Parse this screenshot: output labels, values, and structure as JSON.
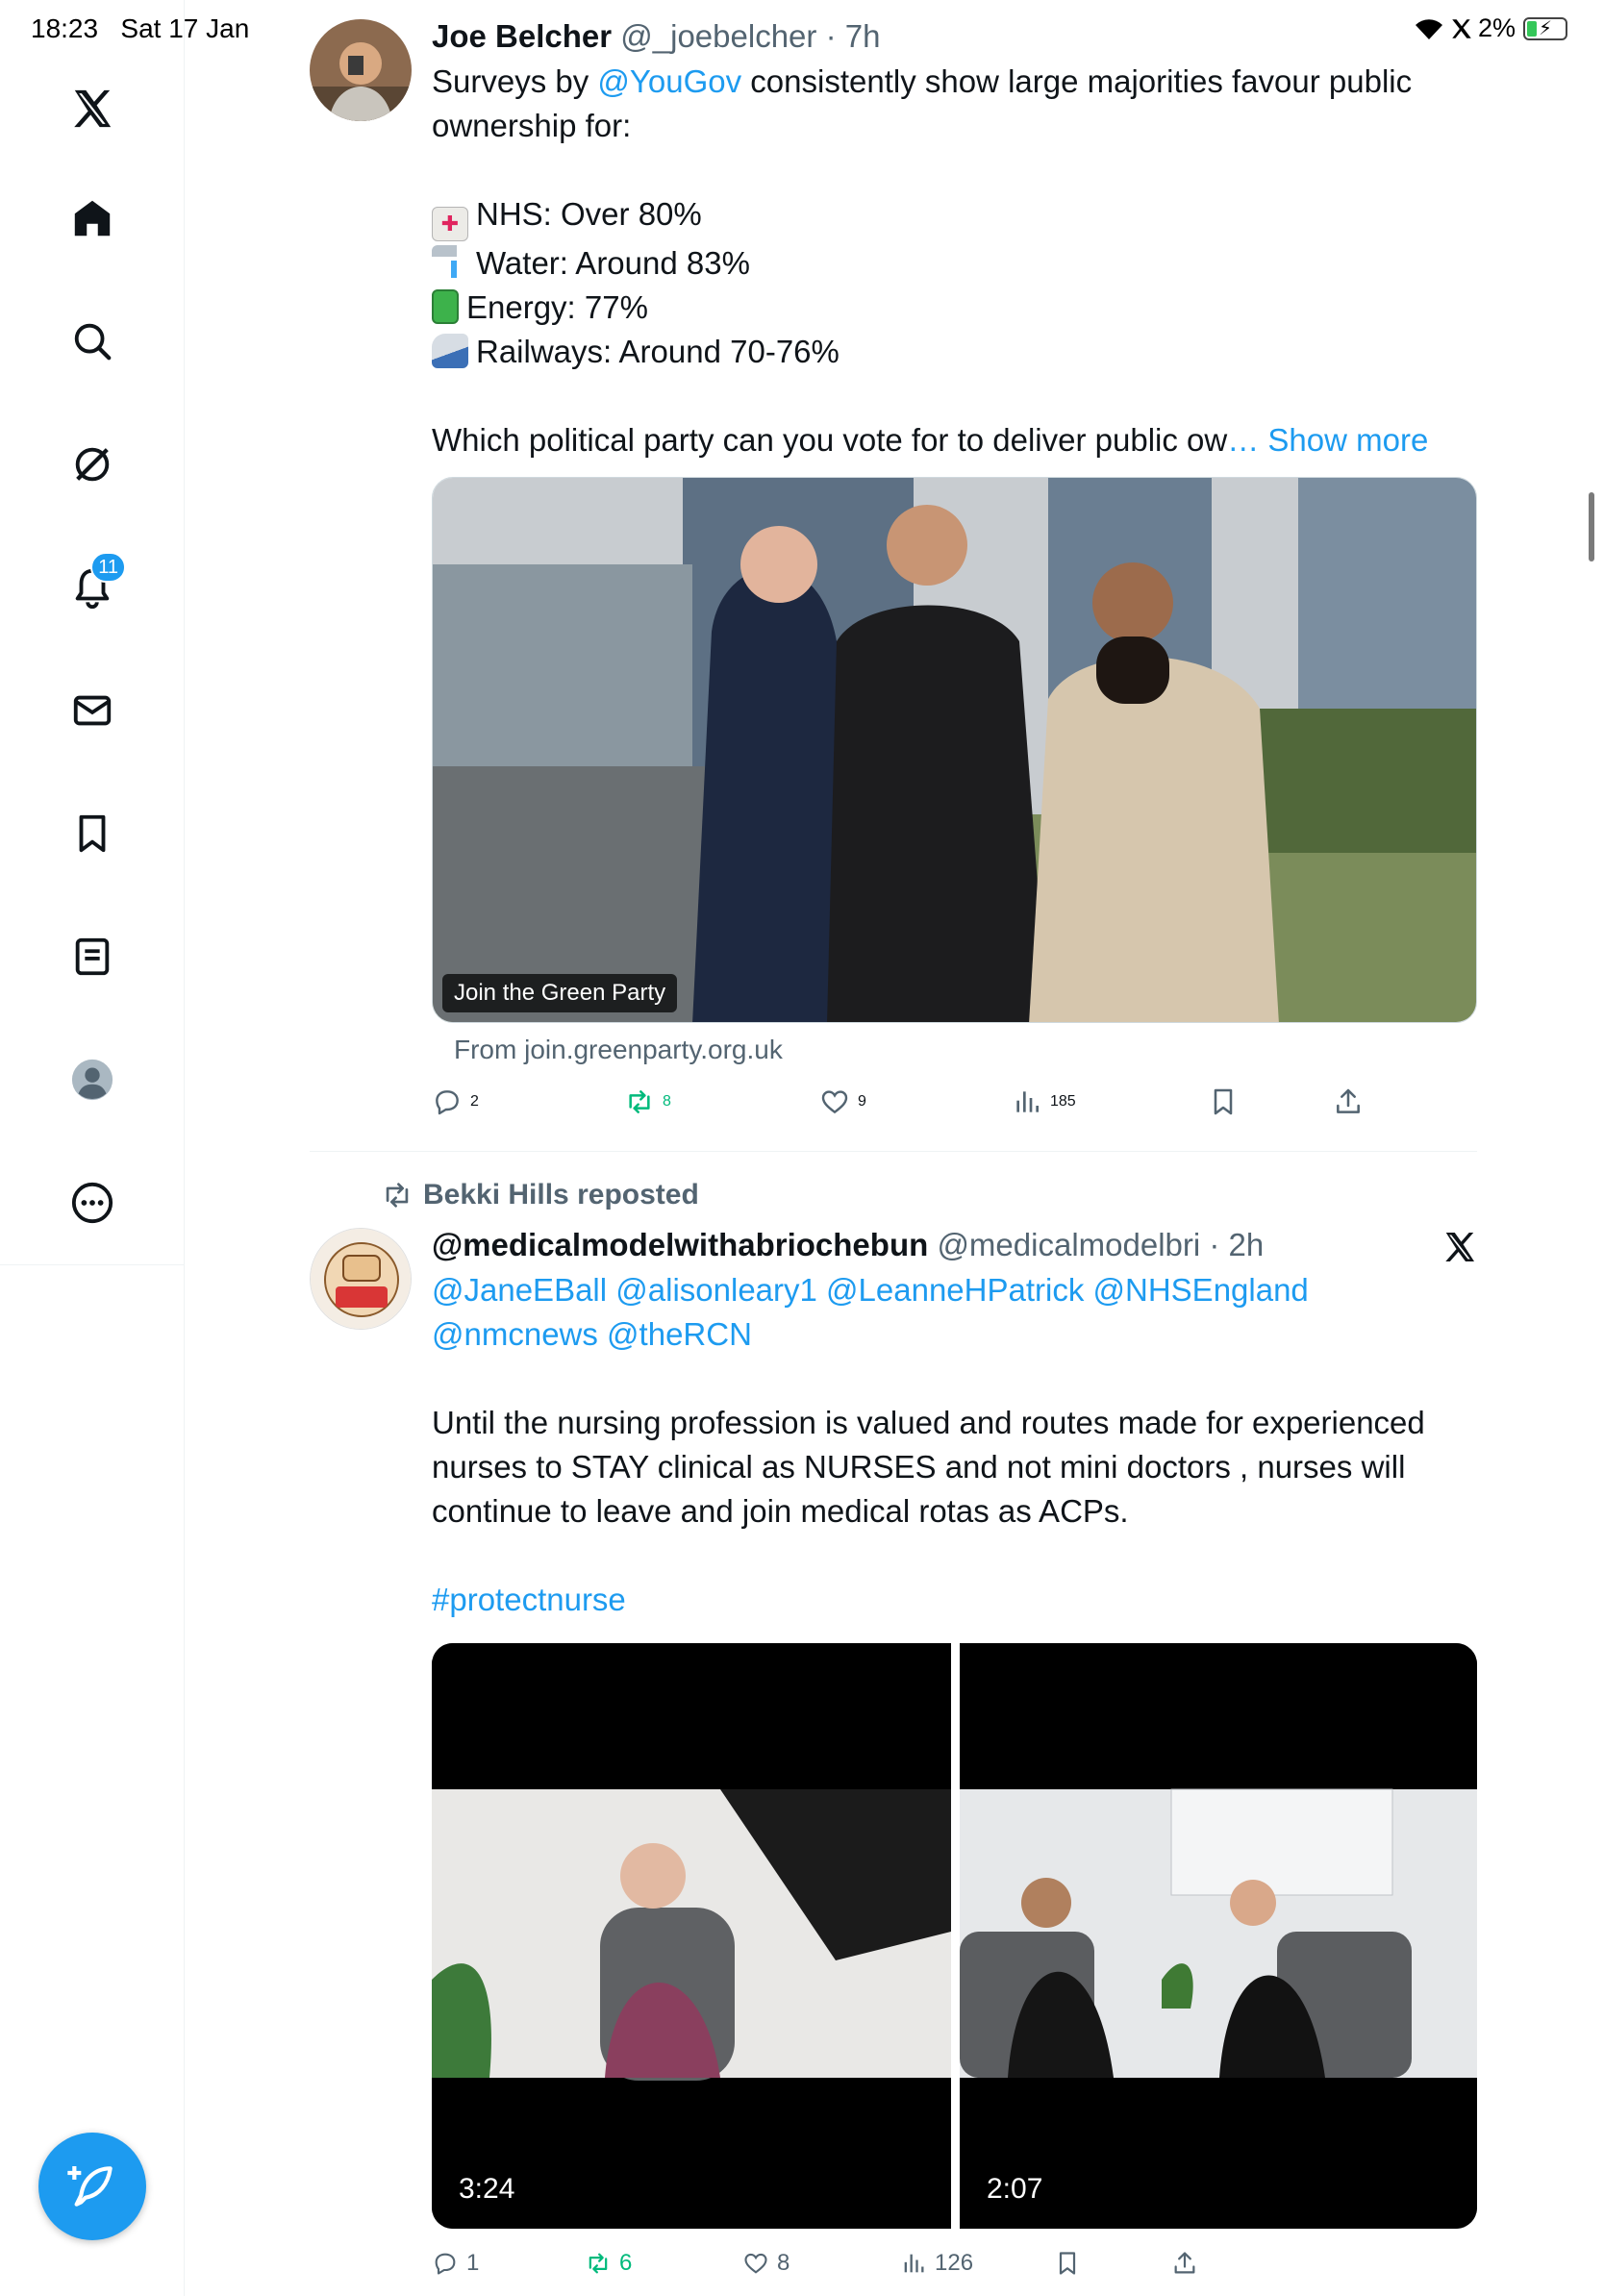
{
  "status_bar": {
    "time": "18:23",
    "date": "Sat 17 Jan",
    "battery": "2%"
  },
  "sidebar": {
    "notifications_badge": "11",
    "items": [
      "home",
      "search",
      "grok",
      "notifications",
      "messages",
      "bookmarks",
      "lists",
      "profile",
      "more"
    ]
  },
  "tweet1": {
    "name": "Joe Belcher",
    "handle": "@_joebelcher",
    "time": "· 7h",
    "text_before_link": "Surveys by ",
    "mention": "@YouGov",
    "text_after_link": " consistently show large majorities favour public",
    "text_line2": "ownership for:",
    "stats": [
      {
        "icon": "hospital-emoji",
        "text": "NHS: Over 80%"
      },
      {
        "icon": "tap-water-emoji",
        "text": "Water: Around 83%"
      },
      {
        "icon": "battery-emoji",
        "text": "Energy: 77%"
      },
      {
        "icon": "train-emoji",
        "text": "Railways: Around 70-76%"
      }
    ],
    "question": "Which political party can you vote for to deliver public ow",
    "show_more": "… Show more",
    "card_caption": "Join the Green Party",
    "card_domain": "From join.greenparty.org.uk",
    "replies": "2",
    "reposts": "8",
    "likes": "9",
    "views": "185"
  },
  "tweet2": {
    "reposted_by": "Bekki Hills reposted",
    "name": "@medicalmodelwithabriochebun",
    "handle": "@medicalmodelbri",
    "time": "· 2h",
    "mentions_line1": "@JaneEBall @alisonleary1 @LeanneHPatrick @NHSEngland",
    "mentions_line2": "@nmcnews @theRCN",
    "body_line1": "Until the nursing profession is valued and routes made for experienced",
    "body_line2": "nurses to STAY clinical as NURSES and not mini doctors , nurses will",
    "body_line3": "continue to leave and join medical rotas as ACPs.",
    "hashtag": "#protectnurse",
    "video1_duration": "3:24",
    "video2_duration": "2:07",
    "replies": "1",
    "reposts": "6",
    "likes": "8",
    "views": "126"
  }
}
